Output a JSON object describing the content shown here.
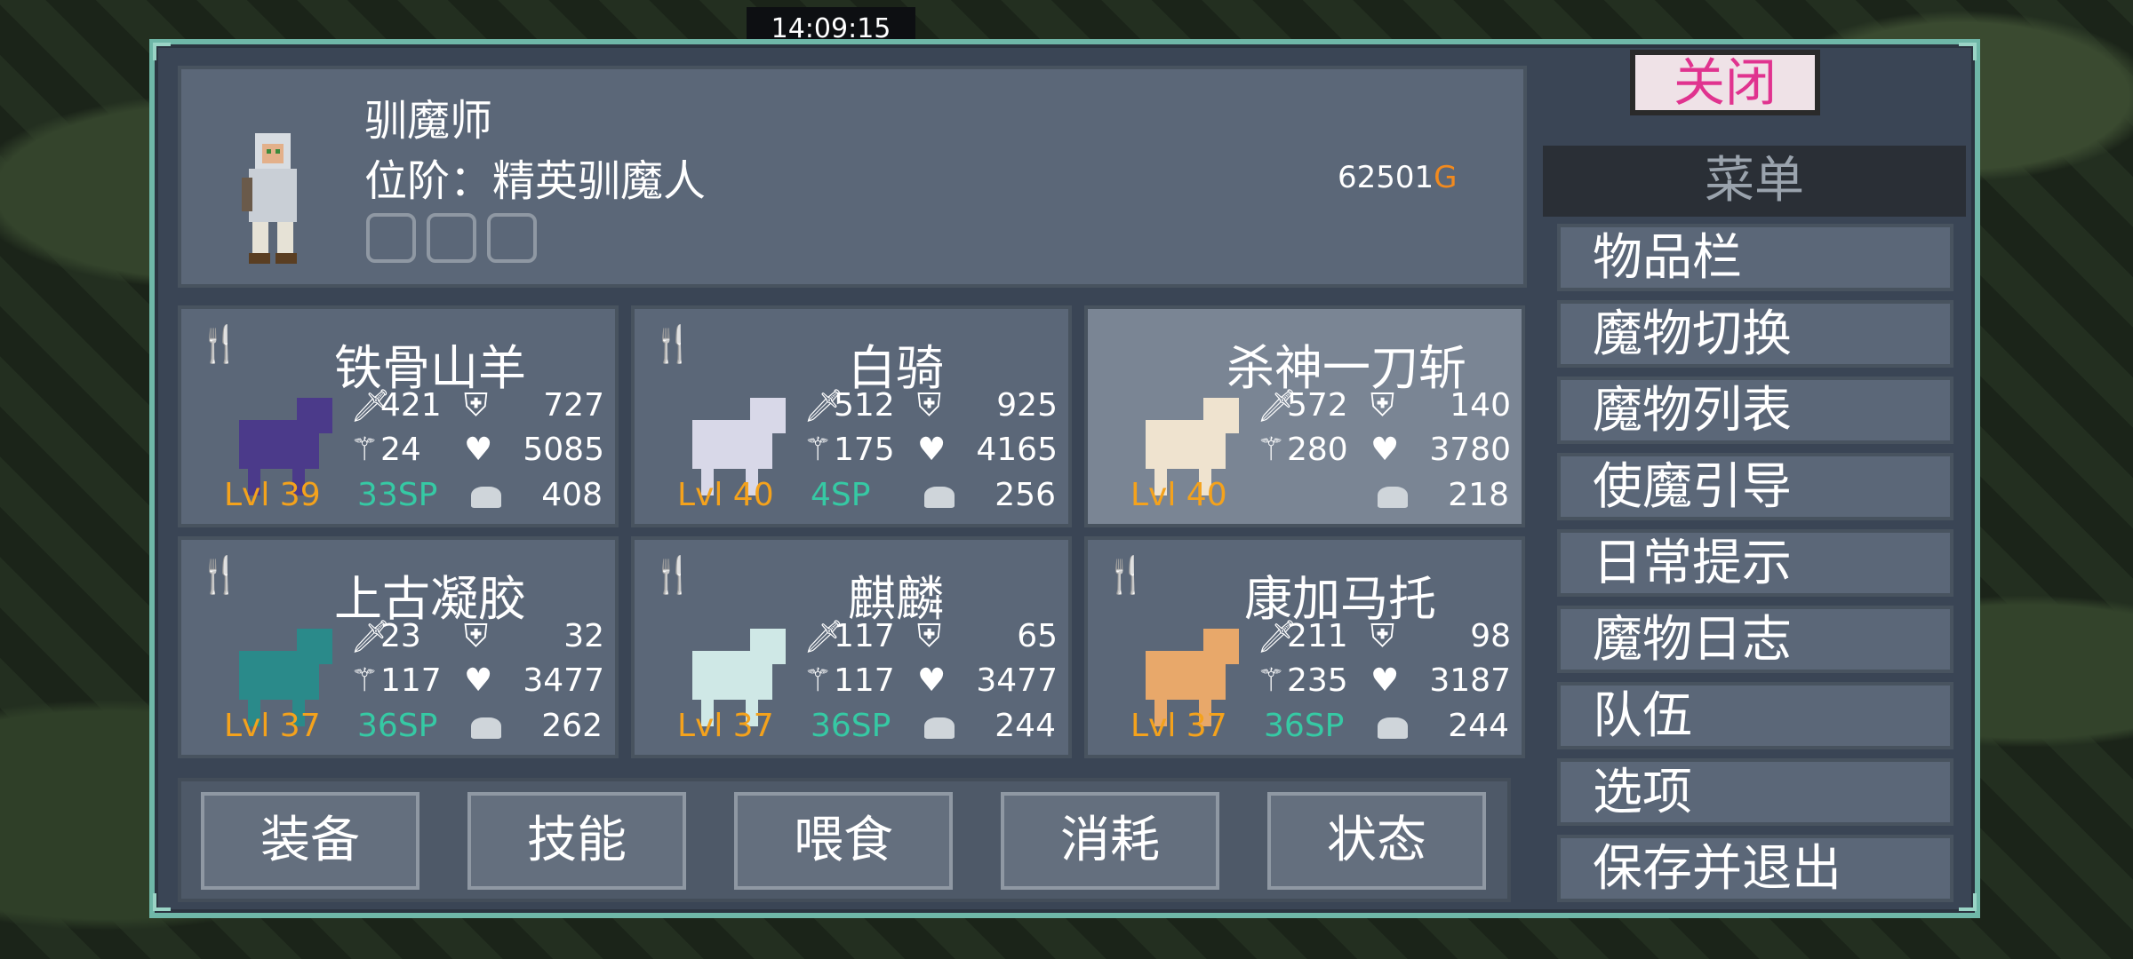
{
  "status_bar": {
    "time": "14:09:15"
  },
  "player": {
    "name": "驯魔师",
    "rank": "位阶：精英驯魔人",
    "gold": "62501",
    "gold_unit": "G"
  },
  "close_label": "关闭",
  "menu": {
    "title": "菜单",
    "items": [
      "物品栏",
      "魔物切换",
      "魔物列表",
      "使魔引导",
      "日常提示",
      "魔物日志",
      "队伍",
      "选项",
      "保存并退出"
    ]
  },
  "monsters": [
    {
      "name": "铁骨山羊",
      "atk": "421",
      "def": "727",
      "matk": "24",
      "hp": "5085",
      "level": "Lvl 39",
      "sp": "33SP",
      "food": "408"
    },
    {
      "name": "白骑",
      "atk": "512",
      "def": "925",
      "matk": "175",
      "hp": "4165",
      "level": "Lvl 40",
      "sp": "4SP",
      "food": "256"
    },
    {
      "name": "杀神一刀斩",
      "atk": "572",
      "def": "140",
      "matk": "280",
      "hp": "3780",
      "level": "Lvl 40",
      "sp": "",
      "food": "218"
    },
    {
      "name": "上古凝胶",
      "atk": "23",
      "def": "32",
      "matk": "117",
      "hp": "3477",
      "level": "Lvl 37",
      "sp": "36SP",
      "food": "262"
    },
    {
      "name": "麒麟",
      "atk": "117",
      "def": "65",
      "matk": "117",
      "hp": "3477",
      "level": "Lvl 37",
      "sp": "36SP",
      "food": "244"
    },
    {
      "name": "康加马托",
      "atk": "211",
      "def": "98",
      "matk": "235",
      "hp": "3187",
      "level": "Lvl 37",
      "sp": "36SP",
      "food": "244"
    }
  ],
  "actions": [
    "装备",
    "技能",
    "喂食",
    "消耗",
    "状态"
  ],
  "colors": {
    "level": "#f4a21c",
    "sp": "#36c9a4",
    "gold_unit": "#f28a1e",
    "close_text": "#e0338f",
    "frame": "#6fb7a8"
  }
}
